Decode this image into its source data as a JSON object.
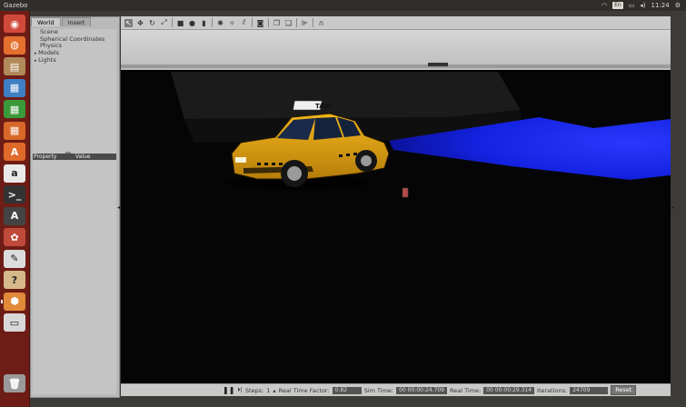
{
  "window": {
    "title": "Gazebo"
  },
  "tray": {
    "keyboard": "En",
    "time": "11:24"
  },
  "launcher": {
    "items": [
      {
        "name": "dash",
        "glyph": "◉",
        "color": "#d04a3c"
      },
      {
        "name": "firefox",
        "glyph": "◍",
        "color": "#e4702e"
      },
      {
        "name": "files",
        "glyph": "▤",
        "color": "#b08a5a"
      },
      {
        "name": "writer",
        "glyph": "▦",
        "color": "#3f7fc4"
      },
      {
        "name": "calc",
        "glyph": "▦",
        "color": "#3a9a3a"
      },
      {
        "name": "impress",
        "glyph": "▦",
        "color": "#d8682a"
      },
      {
        "name": "software-center",
        "glyph": "A",
        "color": "#e06a2a"
      },
      {
        "name": "amazon",
        "glyph": "a",
        "color": "#e9e9e9"
      },
      {
        "name": "terminal",
        "glyph": ">_",
        "color": "#333333"
      },
      {
        "name": "updater",
        "glyph": "A",
        "color": "#444444"
      },
      {
        "name": "settings",
        "glyph": "✿",
        "color": "#c04a3a"
      },
      {
        "name": "editor",
        "glyph": "✎",
        "color": "#dcdcdc"
      },
      {
        "name": "help",
        "glyph": "?",
        "color": "#d6b98a"
      },
      {
        "name": "gazebo",
        "glyph": "⬢",
        "color": "#e08a3a"
      },
      {
        "name": "drive",
        "glyph": "▭",
        "color": "#d8d8d8"
      },
      {
        "name": "trash",
        "glyph": "🗑",
        "color": "#9a9a9a"
      }
    ]
  },
  "panel": {
    "tabs": [
      "World",
      "Insert"
    ],
    "tree": [
      {
        "label": "Scene",
        "expandable": false
      },
      {
        "label": "Spherical Coordinates",
        "expandable": false
      },
      {
        "label": "Physics",
        "expandable": false
      },
      {
        "label": "Models",
        "expandable": true
      },
      {
        "label": "Lights",
        "expandable": true
      }
    ],
    "property_header": "Property",
    "value_header": "Value"
  },
  "toolbar": {
    "tools": [
      {
        "name": "select-tool",
        "glyph": "↖",
        "selected": true
      },
      {
        "name": "translate-tool",
        "glyph": "✥"
      },
      {
        "name": "rotate-tool",
        "glyph": "↻"
      },
      {
        "name": "scale-tool",
        "glyph": "⤢"
      },
      {
        "sep": true
      },
      {
        "name": "box-shape",
        "glyph": "■"
      },
      {
        "name": "sphere-shape",
        "glyph": "●"
      },
      {
        "name": "cylinder-shape",
        "glyph": "▮"
      },
      {
        "sep": true
      },
      {
        "name": "point-light",
        "glyph": "✺"
      },
      {
        "name": "spot-light",
        "glyph": "✧"
      },
      {
        "name": "directional-light",
        "glyph": "⫽"
      },
      {
        "sep": true
      },
      {
        "name": "screenshot",
        "glyph": "◙"
      },
      {
        "sep": true
      },
      {
        "name": "copy",
        "glyph": "❐"
      },
      {
        "name": "paste",
        "glyph": "❏"
      },
      {
        "sep": true
      },
      {
        "name": "align",
        "glyph": "⊫"
      },
      {
        "sep": true
      },
      {
        "name": "snap",
        "glyph": "∩"
      }
    ]
  },
  "status": {
    "steps_label": "Steps:",
    "steps_value": "1",
    "rtf_label": "Real Time Factor:",
    "rtf_value": "0.82",
    "sim_time_label": "Sim Time:",
    "sim_time_value": "00 00:00:24.709",
    "real_time_label": "Real Time:",
    "real_time_value": "00 00:00:29.314",
    "iterations_label": "Iterations:",
    "iterations_value": "24709",
    "reset_label": "Reset"
  },
  "scene": {
    "sign_text": "TAXI"
  }
}
